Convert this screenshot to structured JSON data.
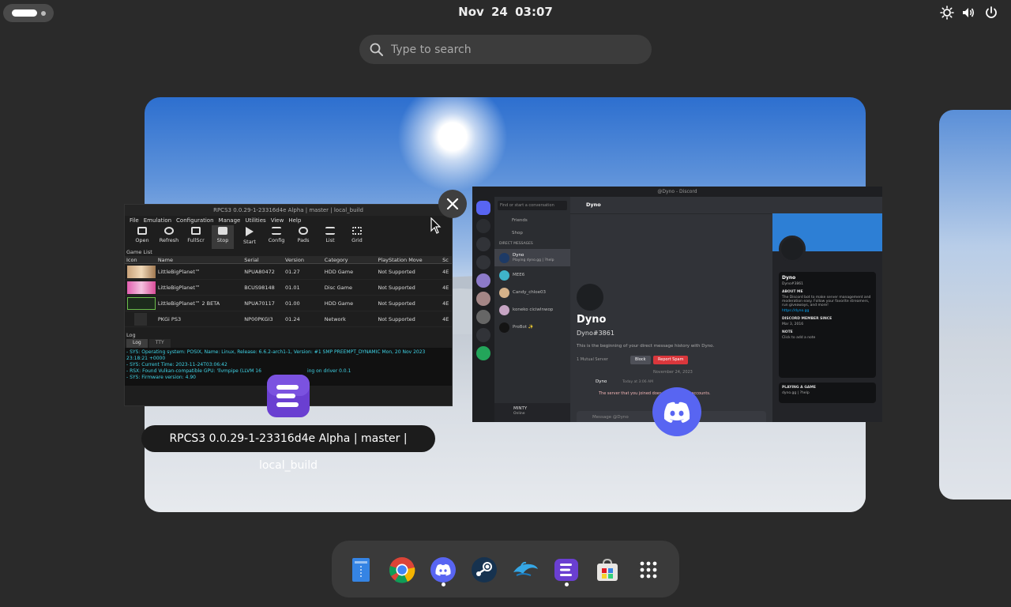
{
  "topbar": {
    "clock": "Nov 24  03:07"
  },
  "search": {
    "placeholder": "Type to search"
  },
  "window_caption": "RPCS3 0.0.29-1-23316d4e Alpha | master | local_build",
  "rpcs3": {
    "title": "RPCS3 0.0.29-1-23316d4e Alpha | master | local_build",
    "menu": [
      "File",
      "Emulation",
      "Configuration",
      "Manage",
      "Utilities",
      "View",
      "Help"
    ],
    "toolbar": [
      "Open",
      "Refresh",
      "FullScr",
      "Stop",
      "Start",
      "Config",
      "Pads",
      "List",
      "Grid"
    ],
    "game_list_title": "Game List",
    "columns": [
      "Icon",
      "Name",
      "Serial",
      "Version",
      "Category",
      "PlayStation Move",
      "Sc"
    ],
    "rows": [
      {
        "name": "LittleBigPlanet™",
        "serial": "NPUA80472",
        "version": "01.27",
        "category": "HDD Game",
        "move": "Not Supported",
        "sc": "4E"
      },
      {
        "name": "LittleBigPlanet™",
        "serial": "BCUS98148",
        "version": "01.01",
        "category": "Disc Game",
        "move": "Not Supported",
        "sc": "4E"
      },
      {
        "name": "LittleBigPlanet™ 2 BETA",
        "serial": "NPUA70117",
        "version": "01.00",
        "category": "HDD Game",
        "move": "Not Supported",
        "sc": "4E"
      },
      {
        "name": "PKGi PS3",
        "serial": "NP00PKGI3",
        "version": "01.24",
        "category": "Network",
        "move": "Not Supported",
        "sc": "4E"
      }
    ],
    "log_title": "Log",
    "log_tabs": [
      "Log",
      "TTY"
    ],
    "log_lines": [
      "- SYS: Operating system: POSIX, Name: Linux, Release: 6.6.2-arch1-1, Version: #1 SMP PREEMPT_DYNAMIC Mon, 20 Nov 2023",
      "23:18:21 +0000",
      "- SYS: Current Time: 2023-11-24T03:06:42",
      "- RSX: Found Vulkan-compatible GPU: 'llvmpipe (LLVM 16",
      "- SYS: Firmware version: 4.90"
    ],
    "log_line_suffix": "ing on driver 0.0.1"
  },
  "discord": {
    "title": "@Dyno - Discord",
    "search_placeholder": "Find or start a conversation",
    "nav": [
      "Friends",
      "Shop"
    ],
    "dm_header": "DIRECT MESSAGES",
    "dms": [
      {
        "name": "Dyno",
        "status": "Playing dyno.gg | ?help"
      },
      {
        "name": "MEE6",
        "status": ""
      },
      {
        "name": "Candy_chloe03",
        "status": ""
      },
      {
        "name": "koneko ciciwlnwop",
        "status": ""
      },
      {
        "name": "ProBot ✨",
        "status": ""
      }
    ],
    "channel_header": "Dyno",
    "big_name": "Dyno",
    "big_tag": "Dyno#3861",
    "intro": "This is the beginning of your direct message history with Dyno.",
    "mutual": "1 Mutual Server",
    "block_label": "Block",
    "report_label": "Report Spam",
    "date_divider": "November 24, 2023",
    "message_author": "Dyno",
    "message_time": "Today at 3:06 AM",
    "message_text": "The server that you joined does not allow new accounts.",
    "compose_placeholder": "Message @Dyno",
    "user_name": "MINTY",
    "user_status": "Online",
    "profile": {
      "name": "Dyno",
      "tag": "Dyno#3861",
      "about_label": "ABOUT ME",
      "about_text": "The Discord bot to make server management and moderation easy. Follow your favorite streamers, run giveaways, and more!",
      "link": "https://dyno.gg",
      "member_label": "DISCORD MEMBER SINCE",
      "member_since": "Mar 3, 2016",
      "note_label": "NOTE",
      "note_placeholder": "Click to add a note",
      "game_label": "PLAYING A GAME",
      "game": "dyno.gg | ?help"
    }
  },
  "dock": {
    "apps": [
      {
        "name": "files",
        "running": false
      },
      {
        "name": "chrome",
        "running": false
      },
      {
        "name": "discord",
        "running": true
      },
      {
        "name": "steam",
        "running": false
      },
      {
        "name": "dolphin",
        "running": false
      },
      {
        "name": "rpcs3",
        "running": true
      },
      {
        "name": "software",
        "running": false
      },
      {
        "name": "app-grid",
        "running": false
      }
    ]
  },
  "colors": {
    "discord_blurple": "#5865f2",
    "rpcs3_purple": "#6a3fd1",
    "log_cyan": "#3fd3e6",
    "report_red": "#da373c"
  }
}
